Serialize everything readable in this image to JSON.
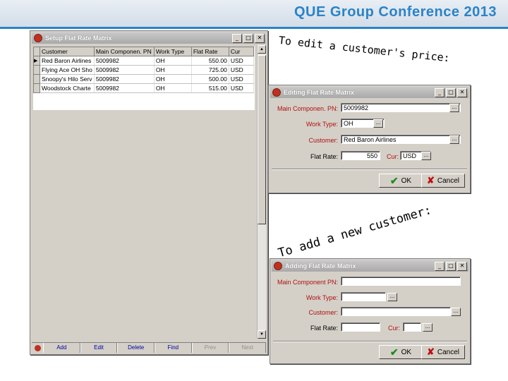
{
  "slide": {
    "conference_title": "QUE Group Conference 2013"
  },
  "annotations": {
    "edit_note": "To edit a customer's price:",
    "add_note_line1": "To add a new customer:"
  },
  "setup_window": {
    "title": "Setup Flat Rate Matrix",
    "columns": [
      "Customer",
      "Main Componen. PN",
      "Work Type",
      "Flat Rate",
      "Cur"
    ],
    "rows": [
      [
        "Red Baron Airlines",
        "5009982",
        "OH",
        "550.00",
        "USD"
      ],
      [
        "Flying Ace OH Sho",
        "5009982",
        "OH",
        "725.00",
        "USD"
      ],
      [
        "Snoopy's Hilo Serv",
        "5009982",
        "OH",
        "500.00",
        "USD"
      ],
      [
        "Woodstock Charte",
        "5009982",
        "OH",
        "515.00",
        "USD"
      ]
    ],
    "nav": {
      "add": "Add",
      "edit": "Edit",
      "delete": "Delete",
      "find": "Find",
      "prev": "Prev",
      "next": "Next"
    }
  },
  "edit_window": {
    "title": "Editing Flat Rate Matrix",
    "main_pn_label": "Main Componen. PN:",
    "main_pn_value": "5009982",
    "work_type_label": "Work Type:",
    "work_type_value": "OH",
    "customer_label": "Customer:",
    "customer_value": "Red Baron Airlines",
    "flat_rate_label": "Flat Rate:",
    "flat_rate_value": "550",
    "cur_label": "Cur:",
    "cur_value": "USD",
    "ok_label": "OK",
    "cancel_label": "Cancel"
  },
  "add_window": {
    "title": "Adding Flat Rate Matrix",
    "main_pn_label": "Main Component PN:",
    "main_pn_value": "",
    "work_type_label": "Work Type:",
    "work_type_value": "",
    "customer_label": "Customer:",
    "customer_value": "",
    "flat_rate_label": "Flat Rate:",
    "flat_rate_value": "",
    "cur_label": "Cur:",
    "cur_value": "",
    "ok_label": "OK",
    "cancel_label": "Cancel"
  },
  "colors": {
    "accent": "#2a83c8",
    "label_red": "#b01010",
    "window_face": "#d4d0c8"
  }
}
